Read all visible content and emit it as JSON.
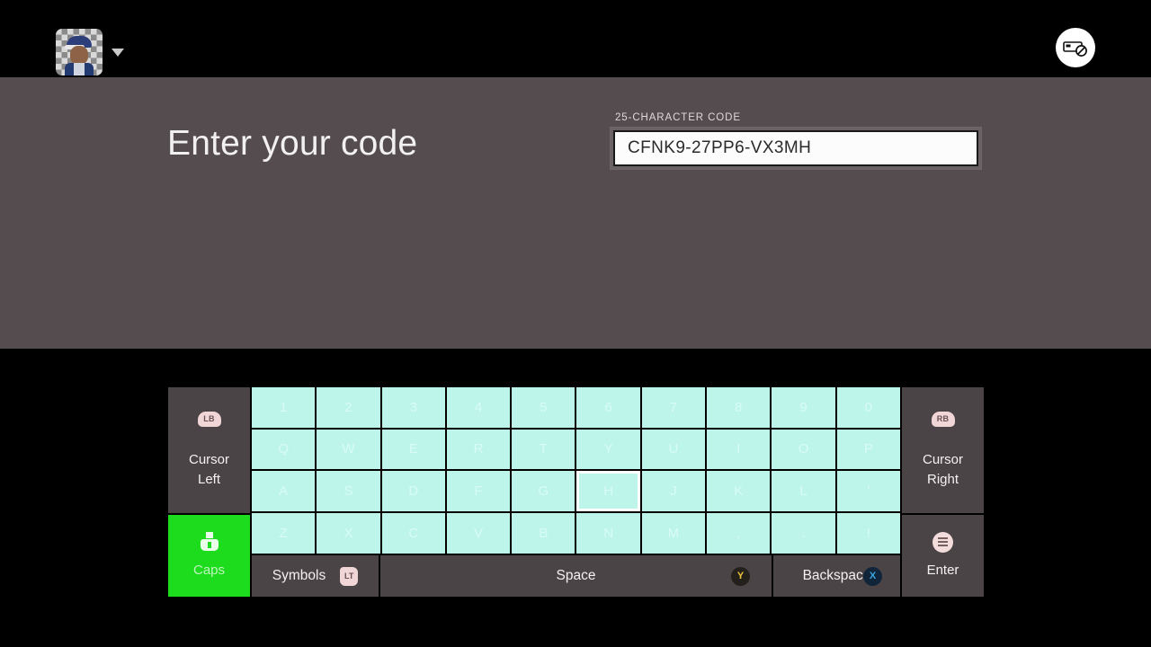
{
  "topbar": {
    "avatar_label": "user-avatar",
    "profile_caret": "▼",
    "status_icon_name": "no-network-card-icon"
  },
  "main": {
    "title": "Enter your code",
    "field": {
      "label": "25-CHARACTER CODE",
      "value": "CFNK9-27PP6-VX3MH",
      "placeholder": "25-CHARACTER CODE"
    }
  },
  "keyboard": {
    "left": {
      "cursor_left": {
        "line1": "Cursor",
        "line2": "Left",
        "badge": "LB"
      },
      "caps": {
        "label": "Caps"
      }
    },
    "right": {
      "cursor_right": {
        "line1": "Cursor",
        "line2": "Right",
        "badge": "RB"
      },
      "enter": {
        "label": "Enter"
      }
    },
    "rows": [
      [
        "1",
        "2",
        "3",
        "4",
        "5",
        "6",
        "7",
        "8",
        "9",
        "0"
      ],
      [
        "Q",
        "W",
        "E",
        "R",
        "T",
        "Y",
        "U",
        "I",
        "O",
        "P"
      ],
      [
        "A",
        "S",
        "D",
        "F",
        "G",
        "H",
        "J",
        "K",
        "L",
        "'"
      ],
      [
        "Z",
        "X",
        "C",
        "V",
        "B",
        "N",
        "M",
        ",",
        ".",
        "!"
      ]
    ],
    "selected_key": "H",
    "bottom": {
      "symbols": {
        "label": "Symbols",
        "badge": "LT"
      },
      "space": {
        "label": "Space",
        "badge": "Y"
      },
      "backspace": {
        "label": "Backspace",
        "badge": "X"
      }
    }
  },
  "colors": {
    "panel_bg": "#554c4f",
    "key_mint": "#bdf5ea",
    "caps_green": "#1ddb1d",
    "fn_grey": "#4a4447"
  }
}
